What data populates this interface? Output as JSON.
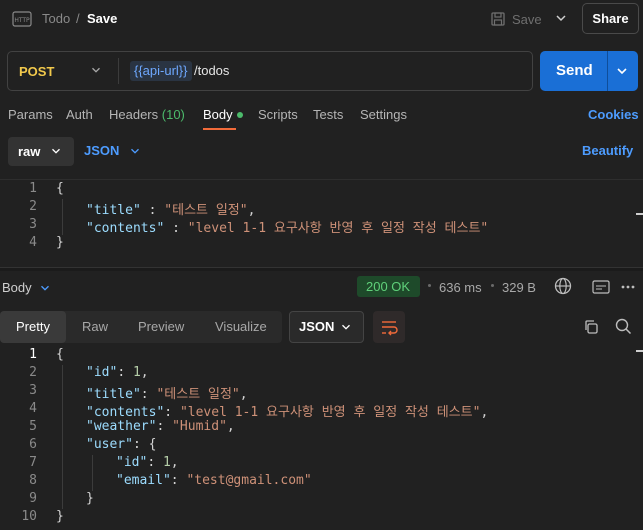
{
  "header": {
    "icon": "http-icon",
    "breadcrumb_parent": "Todo",
    "breadcrumb_sep": "/",
    "breadcrumb_current": "Save",
    "save_label": "Save",
    "share_label": "Share"
  },
  "request": {
    "method": "POST",
    "url_variable": "{{api-url}}",
    "url_path": "/todos",
    "send_label": "Send"
  },
  "tabs": [
    {
      "label": "Params"
    },
    {
      "label": "Auth"
    },
    {
      "label": "Headers",
      "count": "(10)"
    },
    {
      "label": "Body"
    },
    {
      "label": "Scripts"
    },
    {
      "label": "Tests"
    },
    {
      "label": "Settings"
    }
  ],
  "cookies_label": "Cookies",
  "body_options": {
    "mode": "raw",
    "format": "JSON",
    "beautify_label": "Beautify"
  },
  "request_body": {
    "line_numbers": [
      "1",
      "2",
      "3",
      "4"
    ],
    "l1": "{",
    "l2_key": "\"title\"",
    "l2_sep": " : ",
    "l2_val": "\"테스트 일정\"",
    "l2_end": ",",
    "l3_key": "\"contents\"",
    "l3_sep": " : ",
    "l3_val": "\"level 1-1 요구사항 반영 후 일정 작성 테스트\"",
    "l4": "}"
  },
  "response": {
    "section_label": "Body",
    "status": "200 OK",
    "time": "636 ms",
    "size": "329 B",
    "view_tabs": [
      "Pretty",
      "Raw",
      "Preview",
      "Visualize"
    ],
    "format": "JSON",
    "line_numbers": [
      "1",
      "2",
      "3",
      "4",
      "5",
      "6",
      "7",
      "8",
      "9",
      "10"
    ],
    "l1": "{",
    "l2_key": "\"id\"",
    "l2_val": "1",
    "l3_key": "\"title\"",
    "l3_val": "\"테스트 일정\"",
    "l4_key": "\"contents\"",
    "l4_val": "\"level 1-1 요구사항 반영 후 일정 작성 테스트\"",
    "l5_key": "\"weather\"",
    "l5_val": "\"Humid\"",
    "l6_key": "\"user\"",
    "l6_val": "{",
    "l7_key": "\"id\"",
    "l7_val": "1",
    "l8_key": "\"email\"",
    "l8_val": "\"test@gmail.com\"",
    "l9": "}",
    "l10": "}",
    "colon": ": ",
    "comma": ","
  },
  "colors": {
    "accent_blue": "#1a6fd6",
    "method_yellow": "#f2c94c",
    "status_green": "#5fd07a",
    "active_tab_underline": "#f26b3a"
  }
}
